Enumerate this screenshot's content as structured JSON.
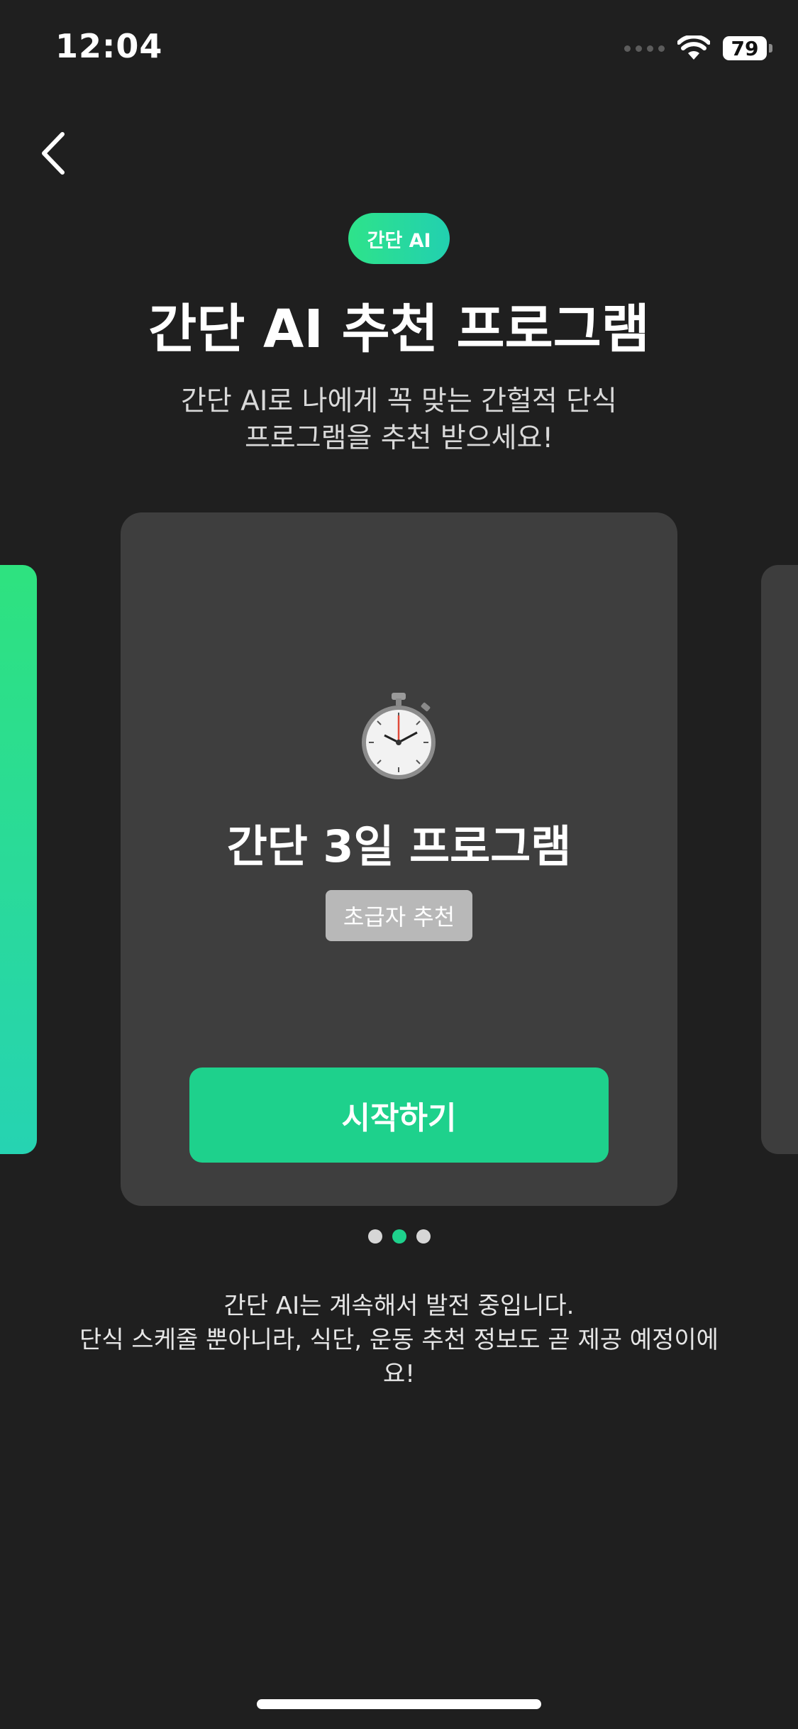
{
  "status_bar": {
    "time": "12:04",
    "battery": "79"
  },
  "header": {
    "badge": "간단 AI",
    "title": "간단 AI 추천 프로그램",
    "subtitle_line1": "간단 AI로 나에게 꼭 맞는 간헐적 단식",
    "subtitle_line2": "프로그램을 추천 받으세요!"
  },
  "carousel": {
    "current_card": {
      "icon": "stopwatch-icon",
      "title": "간단 3일 프로그램",
      "tag": "초급자 추천",
      "button_label": "시작하기"
    },
    "page_count": 3,
    "active_index": 1,
    "left_card_color": "#2ee27f",
    "right_card_color": "#3d3d3d"
  },
  "footer": {
    "line1": "간단 AI는 계속해서 발전 중입니다.",
    "line2": "단식 스케줄 뿐아니라, 식단, 운동 추천 정보도 곧 제공 예정이에",
    "line3": "요!"
  },
  "colors": {
    "background": "#1f1f1f",
    "card": "#3e3e3e",
    "accent": "#1ed18c",
    "tag": "#b8b8b8"
  }
}
